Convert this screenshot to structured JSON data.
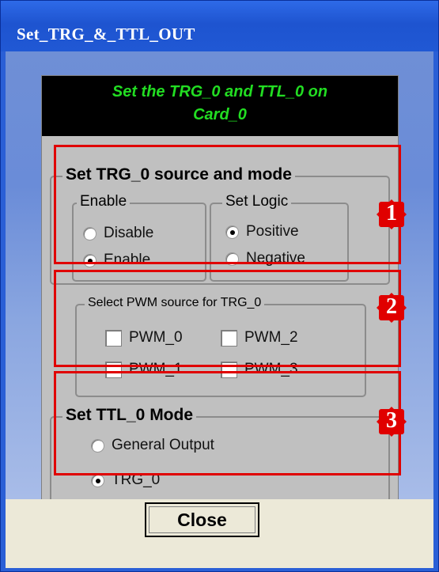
{
  "window": {
    "title": "Set_TRG_&_TTL_OUT"
  },
  "banner": {
    "line1": "Set the TRG_0 and TTL_0 on",
    "line2": "Card_0"
  },
  "trg_group": {
    "title": "Set TRG_0 source and mode",
    "enable": {
      "title": "Enable",
      "options": [
        {
          "label": "Disable",
          "selected": false
        },
        {
          "label": "Enable",
          "selected": true
        }
      ]
    },
    "logic": {
      "title": "Set Logic",
      "options": [
        {
          "label": "Positive",
          "selected": true
        },
        {
          "label": "Negative",
          "selected": false
        }
      ]
    }
  },
  "pwm_group": {
    "title": "Select PWM source for TRG_0",
    "checkboxes": [
      {
        "label": "PWM_0",
        "checked": false
      },
      {
        "label": "PWM_2",
        "checked": false
      },
      {
        "label": "PWM_1",
        "checked": false
      },
      {
        "label": "PWM_3",
        "checked": false
      }
    ]
  },
  "ttl_group": {
    "title": "Set TTL_0 Mode",
    "options": [
      {
        "label": "General Output",
        "selected": false
      },
      {
        "label": "TRG_0",
        "selected": true
      }
    ]
  },
  "badges": [
    "1",
    "2",
    "3"
  ],
  "footer": {
    "close_label": "Close"
  },
  "colors": {
    "title_bar": "#2a5fd6",
    "banner_text": "#22dd22",
    "highlight": "#e00000"
  }
}
